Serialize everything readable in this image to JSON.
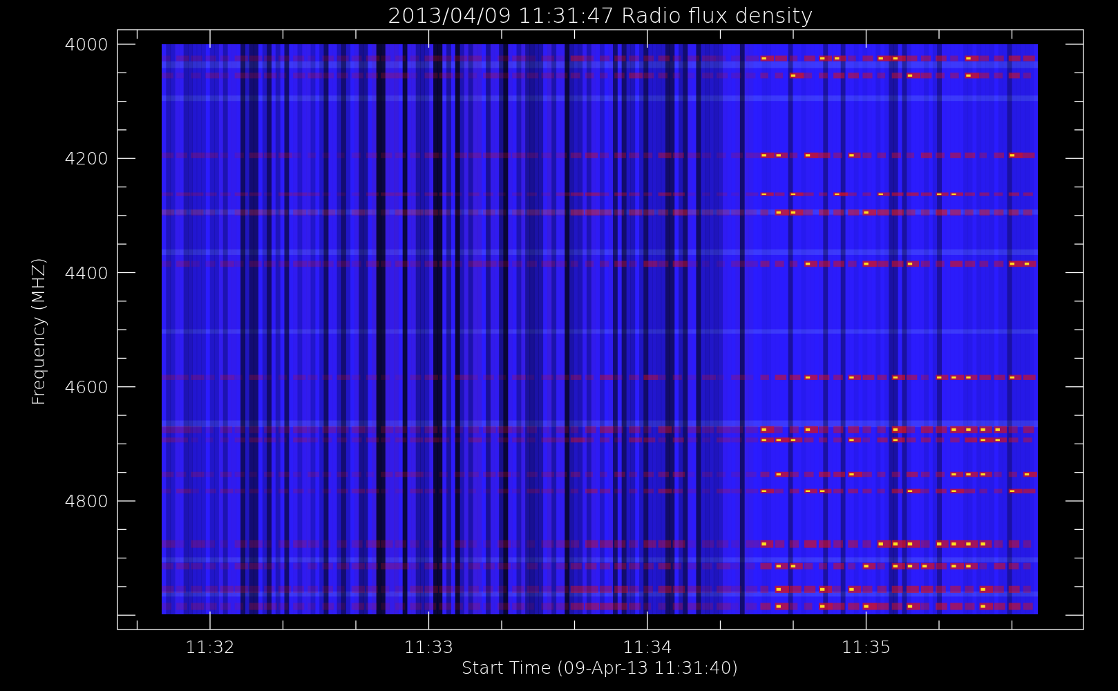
{
  "title": "2013/04/09 11:31:47 Radio flux density",
  "y_axis": {
    "label": "Frequency (MHZ)",
    "ticks": [
      "4000",
      "4200",
      "4400",
      "4600",
      "4800"
    ]
  },
  "x_axis": {
    "label": "Start Time (09-Apr-13 11:31:40)",
    "ticks": [
      "11:32",
      "11:33",
      "11:34",
      "11:35"
    ]
  }
}
